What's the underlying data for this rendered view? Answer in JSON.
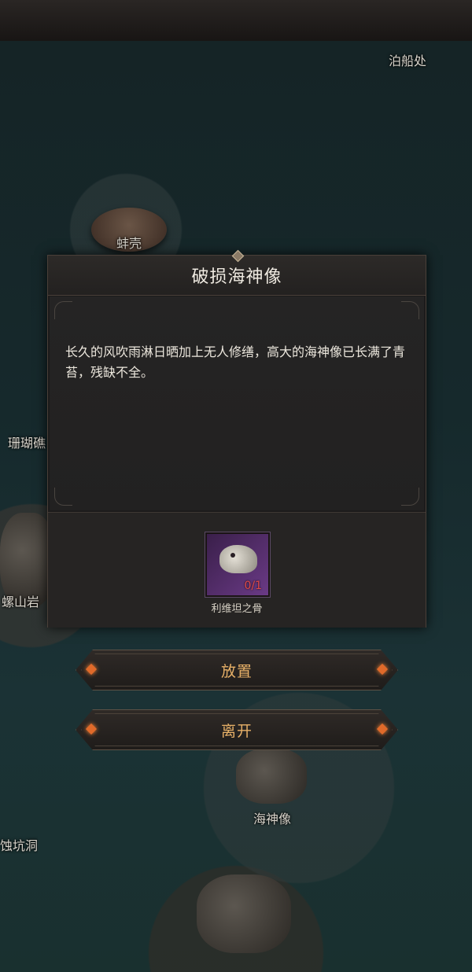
{
  "map": {
    "labels": {
      "dock": "泊船处",
      "shell": "蚌壳",
      "coral": "珊瑚礁",
      "reef": "螺山岩",
      "statue": "海神像",
      "cave": "蚀坑洞"
    }
  },
  "dialog": {
    "title": "破损海神像",
    "description": "长久的风吹雨淋日晒加上无人修缮，高大的海神像已长满了青苔，残缺不全。",
    "item": {
      "icon": "dragon-skull-icon",
      "name": "利维坦之骨",
      "count": "0/1",
      "count_color": "#e04a4a"
    }
  },
  "actions": {
    "place_label": "放置",
    "leave_label": "离开"
  },
  "colors": {
    "accent": "#e8b168",
    "panel_bg": "#1c1b1b"
  }
}
